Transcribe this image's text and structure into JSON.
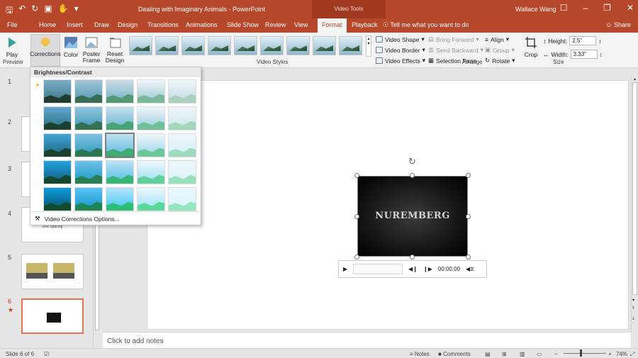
{
  "window": {
    "title": "Dealing with Imaginary Animals - PowerPoint",
    "context_group": "Video Tools",
    "user": "Wallace Wang",
    "share": "Share",
    "tell_me": "Tell me what you want to do"
  },
  "tabs": [
    "File",
    "Home",
    "Insert",
    "Draw",
    "Design",
    "Transitions",
    "Animations",
    "Slide Show",
    "Review",
    "View",
    "Format",
    "Playback"
  ],
  "active_tab": "Format",
  "ribbon": {
    "preview_group": {
      "play": "Play",
      "label": "Preview"
    },
    "adjust_group": {
      "corrections": "Corrections",
      "color": "Color",
      "poster_frame": "Poster Frame",
      "reset_design": "Reset Design"
    },
    "video_styles_label": "Video Styles",
    "video_styles_count": 10,
    "video_shape": "Video Shape",
    "video_border": "Video Border",
    "video_effects": "Video Effects",
    "arrange": {
      "bring_forward": "Bring Forward",
      "send_backward": "Send Backward",
      "selection_pane": "Selection Pane",
      "align": "Align",
      "group": "Group",
      "rotate": "Rotate",
      "label": "Arrange"
    },
    "size": {
      "crop": "Crop",
      "height_label": "Height:",
      "height_value": "2.5\"",
      "width_label": "Width:",
      "width_value": "3.33\"",
      "label": "Size"
    }
  },
  "dropdown": {
    "header": "Brightness/Contrast",
    "option": "Video Corrections Options...",
    "selected_index": 12
  },
  "slides": {
    "numbers": [
      "1",
      "2",
      "3",
      "4",
      "5",
      "6"
    ],
    "current": "6",
    "thumb_texts": {
      "slide4": "Line Spacing"
    }
  },
  "video": {
    "title_text": "NUREMBERG",
    "time": "00:00.00"
  },
  "notes_placeholder": "Click to add notes",
  "status": {
    "slide_info": "Slide 6 of 6",
    "notes": "Notes",
    "comments": "Comments",
    "zoom": "74%"
  },
  "colors": {
    "accent": "#b7472a",
    "accent_dark": "#a0391f",
    "selected_slide_border": "#e6734f"
  }
}
